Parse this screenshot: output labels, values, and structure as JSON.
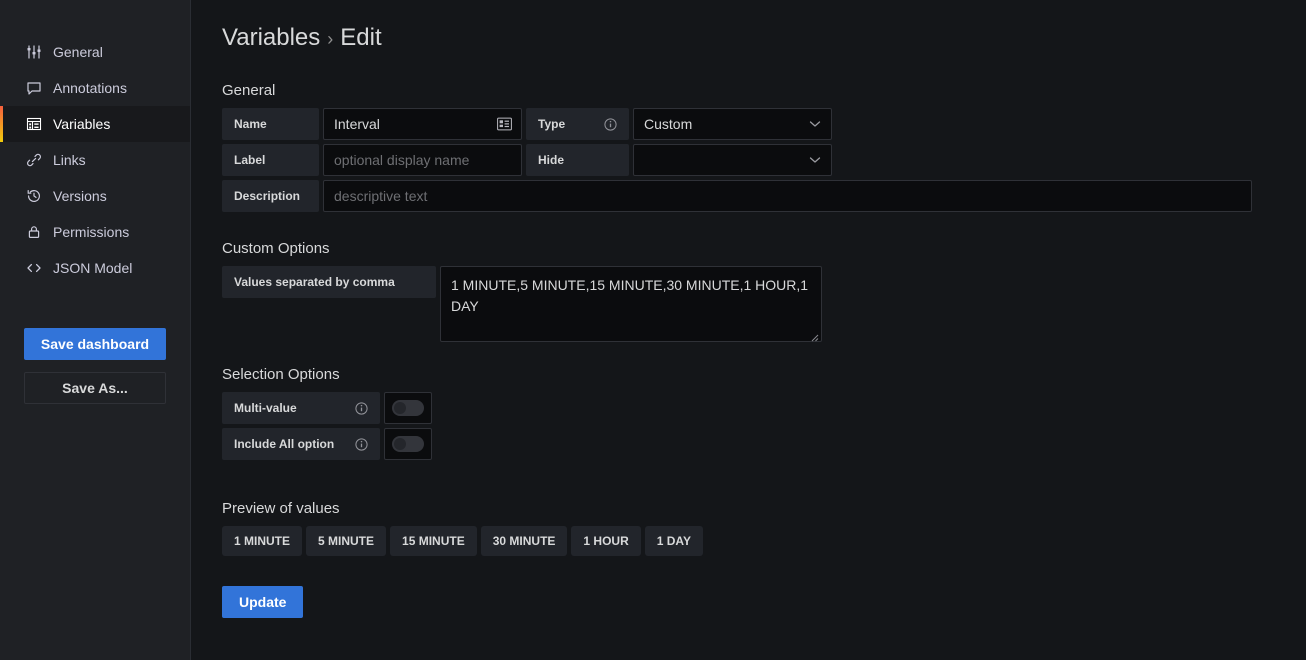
{
  "sidebar": {
    "items": [
      {
        "label": "General",
        "icon": "sliders-icon",
        "active": false
      },
      {
        "label": "Annotations",
        "icon": "comment-icon",
        "active": false
      },
      {
        "label": "Variables",
        "icon": "grid-icon",
        "active": true
      },
      {
        "label": "Links",
        "icon": "link-icon",
        "active": false
      },
      {
        "label": "Versions",
        "icon": "history-icon",
        "active": false
      },
      {
        "label": "Permissions",
        "icon": "lock-icon",
        "active": false
      },
      {
        "label": "JSON Model",
        "icon": "code-icon",
        "active": false
      }
    ],
    "save_dashboard_label": "Save dashboard",
    "save_as_label": "Save As...",
    "accent_gradient_start": "#f55f3e",
    "accent_gradient_end": "#f2cc0c",
    "primary_color": "#3274d9"
  },
  "breadcrumb": {
    "root": "Variables",
    "separator": "›",
    "current": "Edit"
  },
  "general": {
    "title": "General",
    "name_label": "Name",
    "name_value": "Interval",
    "name_icon": "variable-card-icon",
    "type_label": "Type",
    "type_info_icon": "info-circle-icon",
    "type_value": "Custom",
    "label_label": "Label",
    "label_placeholder": "optional display name",
    "hide_label": "Hide",
    "hide_value": "",
    "description_label": "Description",
    "description_placeholder": "descriptive text"
  },
  "custom_options": {
    "title": "Custom Options",
    "values_label": "Values separated by comma",
    "values_value": "1 MINUTE,5 MINUTE,15 MINUTE,30 MINUTE,1 HOUR,1 DAY"
  },
  "selection_options": {
    "title": "Selection Options",
    "multi_value_label": "Multi-value",
    "multi_value_on": false,
    "include_all_label": "Include All option",
    "include_all_on": false,
    "info_icon": "info-circle-icon"
  },
  "preview": {
    "title": "Preview of values",
    "values": [
      "1 MINUTE",
      "5 MINUTE",
      "15 MINUTE",
      "30 MINUTE",
      "1 HOUR",
      "1 DAY"
    ]
  },
  "footer": {
    "update_label": "Update"
  }
}
